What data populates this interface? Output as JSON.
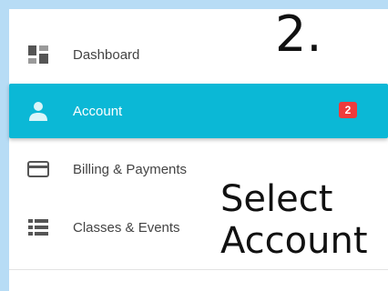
{
  "sidebar": {
    "items": [
      {
        "label": "Dashboard",
        "icon": "dashboard-icon"
      },
      {
        "label": "Account",
        "icon": "user-icon",
        "badge": "2",
        "active": true
      },
      {
        "label": "Billing & Payments",
        "icon": "credit-card-icon"
      },
      {
        "label": "Classes & Events",
        "icon": "list-icon"
      }
    ]
  },
  "annotation": {
    "step": "2.",
    "line1": "Select",
    "line2": "Account"
  },
  "colors": {
    "background": "#b7dcf5",
    "active": "#0bb8d6",
    "badge": "#ef3b3b",
    "icon": "#555555"
  }
}
